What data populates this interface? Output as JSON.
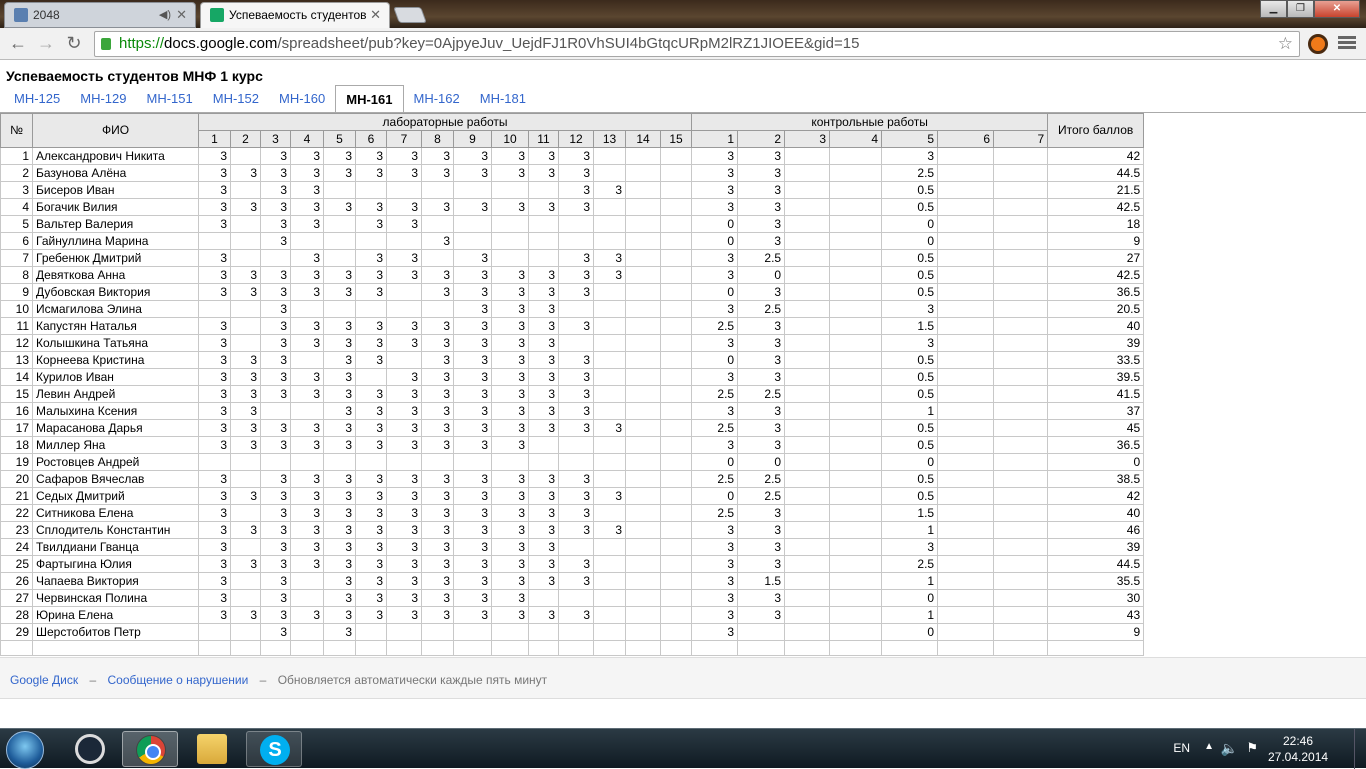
{
  "browser": {
    "tabs": [
      {
        "title": "2048",
        "mute": "◀)"
      },
      {
        "title": "Успеваемость студентов"
      }
    ],
    "url_scheme": "https://",
    "url_host": "docs.google.com",
    "url_path": "/spreadsheet/pub?key=0AjpyeJuv_UejdFJ1R0VhSUI4bGtqcURpM2lRZ1JIOEE&gid=15"
  },
  "doc": {
    "title": "Успеваемость студентов МНФ 1 курс",
    "sheet_tabs": [
      "МН-125",
      "МН-129",
      "МН-151",
      "МН-152",
      "МН-160",
      "МН-161",
      "МН-162",
      "МН-181"
    ],
    "active_tab": "МН-161"
  },
  "table": {
    "col_num": "№",
    "col_name": "ФИО",
    "group_labs": "лабораторные работы",
    "group_tests": "контрольные работы",
    "col_total": "Итого баллов",
    "lab_numbers": [
      "1",
      "2",
      "3",
      "4",
      "5",
      "6",
      "7",
      "8",
      "9",
      "10",
      "11",
      "12",
      "13",
      "14",
      "15"
    ],
    "test_numbers": [
      "1",
      "2",
      "3",
      "4",
      "5",
      "6",
      "7"
    ],
    "rows": [
      {
        "n": "1",
        "name": "Александрович Никита",
        "labs": [
          "3",
          "",
          "3",
          "3",
          "3",
          "3",
          "3",
          "3",
          "3",
          "3",
          "3",
          "3",
          "",
          "",
          ""
        ],
        "tests": [
          "3",
          "3",
          "",
          "",
          "3",
          "",
          ""
        ],
        "total": "42"
      },
      {
        "n": "2",
        "name": "Базунова Алёна",
        "labs": [
          "3",
          "3",
          "3",
          "3",
          "3",
          "3",
          "3",
          "3",
          "3",
          "3",
          "3",
          "3",
          "",
          "",
          ""
        ],
        "tests": [
          "3",
          "3",
          "",
          "",
          "2.5",
          "",
          ""
        ],
        "total": "44.5"
      },
      {
        "n": "3",
        "name": "Бисеров Иван",
        "labs": [
          "3",
          "",
          "3",
          "3",
          "",
          "",
          "",
          "",
          "",
          "",
          "",
          "3",
          "3",
          "",
          ""
        ],
        "tests": [
          "3",
          "3",
          "",
          "",
          "0.5",
          "",
          ""
        ],
        "total": "21.5"
      },
      {
        "n": "4",
        "name": "Богачик Вилия",
        "labs": [
          "3",
          "3",
          "3",
          "3",
          "3",
          "3",
          "3",
          "3",
          "3",
          "3",
          "3",
          "3",
          "",
          "",
          ""
        ],
        "tests": [
          "3",
          "3",
          "",
          "",
          "0.5",
          "",
          ""
        ],
        "total": "42.5"
      },
      {
        "n": "5",
        "name": "Вальтер Валерия",
        "labs": [
          "3",
          "",
          "3",
          "3",
          "",
          "3",
          "3",
          "",
          "",
          "",
          "",
          "",
          "",
          "",
          ""
        ],
        "tests": [
          "0",
          "3",
          "",
          "",
          "0",
          "",
          ""
        ],
        "total": "18"
      },
      {
        "n": "6",
        "name": "Гайнуллина Марина",
        "labs": [
          "",
          "",
          "3",
          "",
          "",
          "",
          "",
          "3",
          "",
          "",
          "",
          "",
          "",
          "",
          ""
        ],
        "tests": [
          "0",
          "3",
          "",
          "",
          "0",
          "",
          ""
        ],
        "total": "9"
      },
      {
        "n": "7",
        "name": "Гребенюк Дмитрий",
        "labs": [
          "3",
          "",
          "",
          "3",
          "",
          "3",
          "3",
          "",
          "3",
          "",
          "",
          "3",
          "3",
          "",
          ""
        ],
        "tests": [
          "3",
          "2.5",
          "",
          "",
          "0.5",
          "",
          ""
        ],
        "total": "27"
      },
      {
        "n": "8",
        "name": "Девяткова Анна",
        "labs": [
          "3",
          "3",
          "3",
          "3",
          "3",
          "3",
          "3",
          "3",
          "3",
          "3",
          "3",
          "3",
          "3",
          "",
          ""
        ],
        "tests": [
          "3",
          "0",
          "",
          "",
          "0.5",
          "",
          ""
        ],
        "total": "42.5"
      },
      {
        "n": "9",
        "name": "Дубовская Виктория",
        "labs": [
          "3",
          "3",
          "3",
          "3",
          "3",
          "3",
          "",
          "3",
          "3",
          "3",
          "3",
          "3",
          "",
          "",
          ""
        ],
        "tests": [
          "0",
          "3",
          "",
          "",
          "0.5",
          "",
          ""
        ],
        "total": "36.5"
      },
      {
        "n": "10",
        "name": "Исмагилова Элина",
        "labs": [
          "",
          "",
          "3",
          "",
          "",
          "",
          "",
          "",
          "3",
          "3",
          "3",
          "",
          "",
          "",
          ""
        ],
        "tests": [
          "3",
          "2.5",
          "",
          "",
          "3",
          "",
          ""
        ],
        "total": "20.5"
      },
      {
        "n": "11",
        "name": "Капустян Наталья",
        "labs": [
          "3",
          "",
          "3",
          "3",
          "3",
          "3",
          "3",
          "3",
          "3",
          "3",
          "3",
          "3",
          "",
          "",
          ""
        ],
        "tests": [
          "2.5",
          "3",
          "",
          "",
          "1.5",
          "",
          ""
        ],
        "total": "40"
      },
      {
        "n": "12",
        "name": "Колышкина Татьяна",
        "labs": [
          "3",
          "",
          "3",
          "3",
          "3",
          "3",
          "3",
          "3",
          "3",
          "3",
          "3",
          "",
          "",
          "",
          ""
        ],
        "tests": [
          "3",
          "3",
          "",
          "",
          "3",
          "",
          ""
        ],
        "total": "39"
      },
      {
        "n": "13",
        "name": "Корнеева Кристина",
        "labs": [
          "3",
          "3",
          "3",
          "",
          "3",
          "3",
          "",
          "3",
          "3",
          "3",
          "3",
          "3",
          "",
          "",
          ""
        ],
        "tests": [
          "0",
          "3",
          "",
          "",
          "0.5",
          "",
          ""
        ],
        "total": "33.5"
      },
      {
        "n": "14",
        "name": "Курилов Иван",
        "labs": [
          "3",
          "3",
          "3",
          "3",
          "3",
          "",
          "3",
          "3",
          "3",
          "3",
          "3",
          "3",
          "",
          "",
          ""
        ],
        "tests": [
          "3",
          "3",
          "",
          "",
          "0.5",
          "",
          ""
        ],
        "total": "39.5"
      },
      {
        "n": "15",
        "name": "Левин Андрей",
        "labs": [
          "3",
          "3",
          "3",
          "3",
          "3",
          "3",
          "3",
          "3",
          "3",
          "3",
          "3",
          "3",
          "",
          "",
          ""
        ],
        "tests": [
          "2.5",
          "2.5",
          "",
          "",
          "0.5",
          "",
          ""
        ],
        "total": "41.5"
      },
      {
        "n": "16",
        "name": "Малыхина Ксения",
        "labs": [
          "3",
          "3",
          "",
          "",
          "3",
          "3",
          "3",
          "3",
          "3",
          "3",
          "3",
          "3",
          "",
          "",
          ""
        ],
        "tests": [
          "3",
          "3",
          "",
          "",
          "1",
          "",
          ""
        ],
        "total": "37"
      },
      {
        "n": "17",
        "name": "Марасанова Дарья",
        "labs": [
          "3",
          "3",
          "3",
          "3",
          "3",
          "3",
          "3",
          "3",
          "3",
          "3",
          "3",
          "3",
          "3",
          "",
          ""
        ],
        "tests": [
          "2.5",
          "3",
          "",
          "",
          "0.5",
          "",
          ""
        ],
        "total": "45"
      },
      {
        "n": "18",
        "name": "Миллер Яна",
        "labs": [
          "3",
          "3",
          "3",
          "3",
          "3",
          "3",
          "3",
          "3",
          "3",
          "3",
          "",
          "",
          "",
          "",
          ""
        ],
        "tests": [
          "3",
          "3",
          "",
          "",
          "0.5",
          "",
          ""
        ],
        "total": "36.5"
      },
      {
        "n": "19",
        "name": "Ростовцев Андрей",
        "labs": [
          "",
          "",
          "",
          "",
          "",
          "",
          "",
          "",
          "",
          "",
          "",
          "",
          "",
          "",
          ""
        ],
        "tests": [
          "0",
          "0",
          "",
          "",
          "0",
          "",
          ""
        ],
        "total": "0"
      },
      {
        "n": "20",
        "name": "Сафаров Вячеслав",
        "labs": [
          "3",
          "",
          "3",
          "3",
          "3",
          "3",
          "3",
          "3",
          "3",
          "3",
          "3",
          "3",
          "",
          "",
          ""
        ],
        "tests": [
          "2.5",
          "2.5",
          "",
          "",
          "0.5",
          "",
          ""
        ],
        "total": "38.5"
      },
      {
        "n": "21",
        "name": "Седых Дмитрий",
        "labs": [
          "3",
          "3",
          "3",
          "3",
          "3",
          "3",
          "3",
          "3",
          "3",
          "3",
          "3",
          "3",
          "3",
          "",
          ""
        ],
        "tests": [
          "0",
          "2.5",
          "",
          "",
          "0.5",
          "",
          ""
        ],
        "total": "42"
      },
      {
        "n": "22",
        "name": "Ситникова Елена",
        "labs": [
          "3",
          "",
          "3",
          "3",
          "3",
          "3",
          "3",
          "3",
          "3",
          "3",
          "3",
          "3",
          "",
          "",
          ""
        ],
        "tests": [
          "2.5",
          "3",
          "",
          "",
          "1.5",
          "",
          ""
        ],
        "total": "40"
      },
      {
        "n": "23",
        "name": "Сплодитель Константин",
        "labs": [
          "3",
          "3",
          "3",
          "3",
          "3",
          "3",
          "3",
          "3",
          "3",
          "3",
          "3",
          "3",
          "3",
          "",
          ""
        ],
        "tests": [
          "3",
          "3",
          "",
          "",
          "1",
          "",
          ""
        ],
        "total": "46"
      },
      {
        "n": "24",
        "name": "Твилдиани Гванца",
        "labs": [
          "3",
          "",
          "3",
          "3",
          "3",
          "3",
          "3",
          "3",
          "3",
          "3",
          "3",
          "",
          "",
          "",
          ""
        ],
        "tests": [
          "3",
          "3",
          "",
          "",
          "3",
          "",
          ""
        ],
        "total": "39"
      },
      {
        "n": "25",
        "name": "Фартыгина Юлия",
        "labs": [
          "3",
          "3",
          "3",
          "3",
          "3",
          "3",
          "3",
          "3",
          "3",
          "3",
          "3",
          "3",
          "",
          "",
          ""
        ],
        "tests": [
          "3",
          "3",
          "",
          "",
          "2.5",
          "",
          ""
        ],
        "total": "44.5"
      },
      {
        "n": "26",
        "name": "Чапаева Виктория",
        "labs": [
          "3",
          "",
          "3",
          "",
          "3",
          "3",
          "3",
          "3",
          "3",
          "3",
          "3",
          "3",
          "",
          "",
          ""
        ],
        "tests": [
          "3",
          "1.5",
          "",
          "",
          "1",
          "",
          ""
        ],
        "total": "35.5"
      },
      {
        "n": "27",
        "name": "Червинская Полина",
        "labs": [
          "3",
          "",
          "3",
          "",
          "3",
          "3",
          "3",
          "3",
          "3",
          "3",
          "",
          "",
          "",
          "",
          ""
        ],
        "tests": [
          "3",
          "3",
          "",
          "",
          "0",
          "",
          ""
        ],
        "total": "30"
      },
      {
        "n": "28",
        "name": "Юрина Елена",
        "labs": [
          "3",
          "3",
          "3",
          "3",
          "3",
          "3",
          "3",
          "3",
          "3",
          "3",
          "3",
          "3",
          "",
          "",
          ""
        ],
        "tests": [
          "3",
          "3",
          "",
          "",
          "1",
          "",
          ""
        ],
        "total": "43"
      },
      {
        "n": "29",
        "name": "Шерстобитов Петр",
        "labs": [
          "",
          "",
          "3",
          "",
          "3",
          "",
          "",
          "",
          "",
          "",
          "",
          "",
          "",
          "",
          ""
        ],
        "tests": [
          "3",
          "",
          "",
          "",
          "0",
          "",
          ""
        ],
        "total": "9"
      }
    ]
  },
  "footer": {
    "link_drive": "Google Диск",
    "sep": "–",
    "link_report": "Сообщение о нарушении",
    "auto_update": "Обновляется автоматически каждые пять минут"
  },
  "taskbar": {
    "lang": "EN",
    "time": "22:46",
    "date": "27.04.2014"
  }
}
